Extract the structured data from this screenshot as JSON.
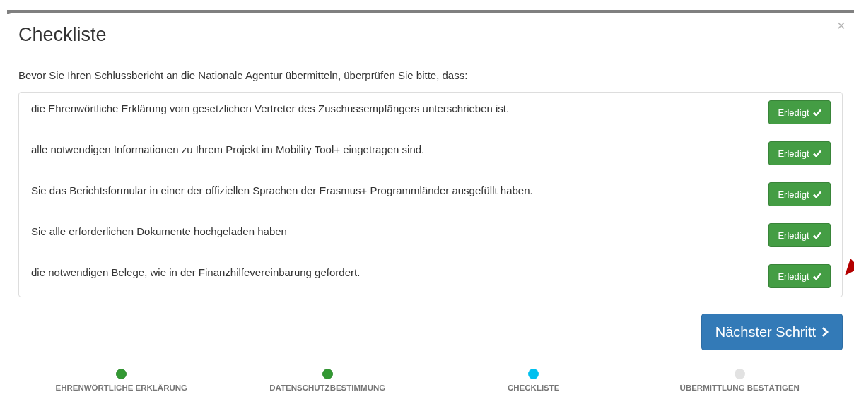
{
  "dialog": {
    "title": "Checkliste",
    "close": "×"
  },
  "intro": "Bevor Sie Ihren Schlussbericht an die Nationale Agentur übermitteln, überprüfen Sie bitte, dass:",
  "items": [
    {
      "text": "die Ehrenwörtliche Erklärung vom gesetzlichen Vertreter des Zuschussempfängers unterschrieben ist.",
      "button": "Erledigt",
      "done": true
    },
    {
      "text": "alle notwendigen Informationen zu Ihrem Projekt im Mobility Tool+ eingetragen sind.",
      "button": "Erledigt",
      "done": true
    },
    {
      "text": "Sie das Berichtsformular in einer der offiziellen Sprachen der Erasmus+ Programmländer ausgefüllt haben.",
      "button": "Erledigt",
      "done": true
    },
    {
      "text": "Sie alle erforderlichen Dokumente hochgeladen haben",
      "button": "Erledigt",
      "done": true
    },
    {
      "text": "die notwendigen Belege, wie in der Finanzhilfevereinbarung gefordert.",
      "button": "Erledigt",
      "done": true
    }
  ],
  "next_button": "Nächster Schritt",
  "steps": [
    {
      "label": "EHRENWÖRTLICHE ERKLÄRUNG",
      "done": true,
      "selected": false
    },
    {
      "label": "DATENSCHUTZBESTIMMUNG",
      "done": true,
      "selected": false
    },
    {
      "label": "CHECKLISTE",
      "done": false,
      "selected": true
    },
    {
      "label": "ÜBERMITTLUNG BESTÄTIGEN",
      "done": false,
      "selected": false
    }
  ]
}
